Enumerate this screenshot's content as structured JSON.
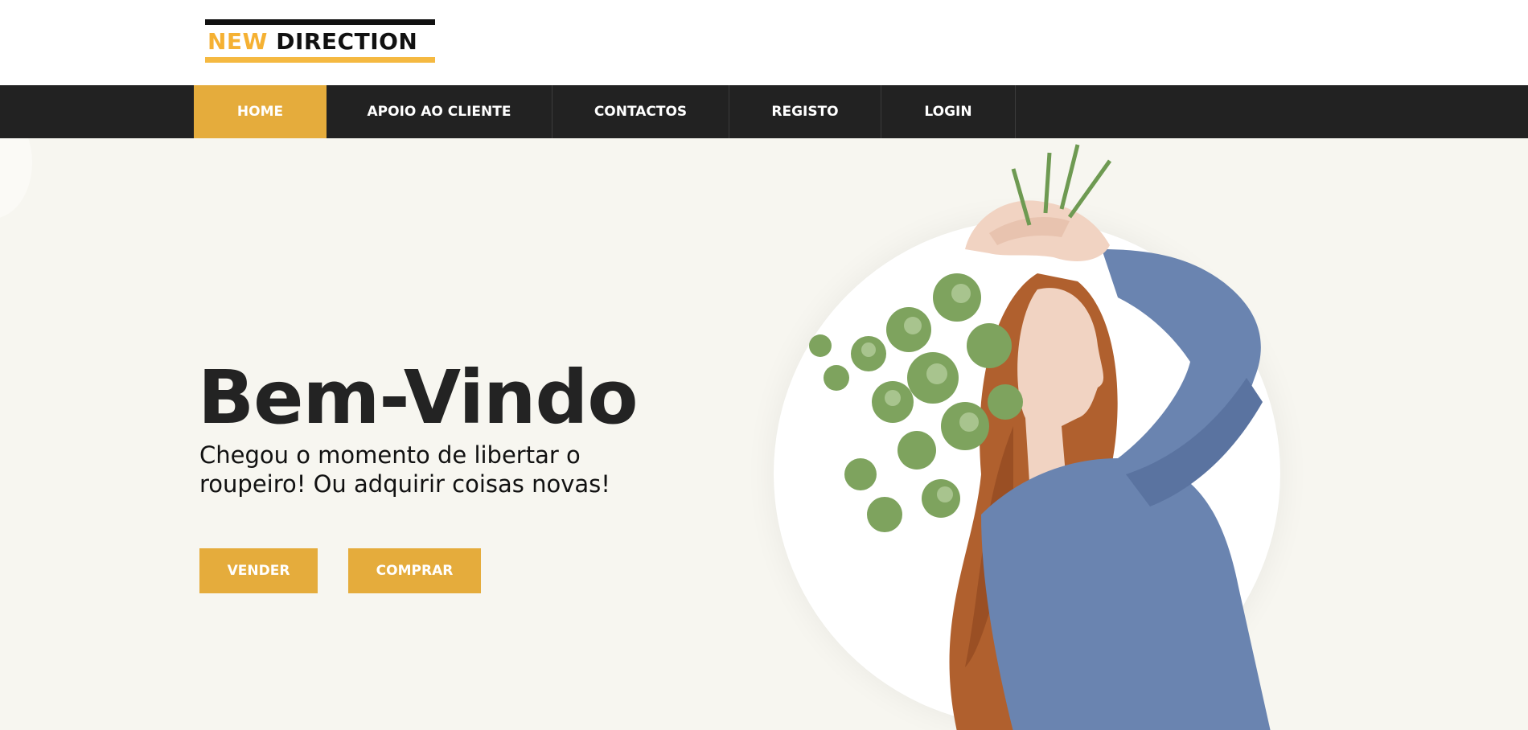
{
  "logo": {
    "word1": "NEW",
    "word2": "DIRECTION"
  },
  "nav": {
    "items": [
      {
        "label": "HOME",
        "active": true
      },
      {
        "label": "APOIO AO CLIENTE",
        "active": false
      },
      {
        "label": "CONTACTOS",
        "active": false
      },
      {
        "label": "REGISTO",
        "active": false
      },
      {
        "label": "LOGIN",
        "active": false
      }
    ]
  },
  "hero": {
    "title": "Bem-Vindo",
    "subtitle": "Chegou o momento de libertar o roupeiro! Ou adquirir coisas novas!",
    "buttons": {
      "sell": "VENDER",
      "buy": "COMPRAR"
    }
  },
  "colors": {
    "accent": "#e5ac3c",
    "nav_bg": "#222222",
    "hero_bg": "#f7f6f0",
    "sweater": "#6a84b0",
    "hair": "#b0602e",
    "leaves": "#6e9a52"
  }
}
